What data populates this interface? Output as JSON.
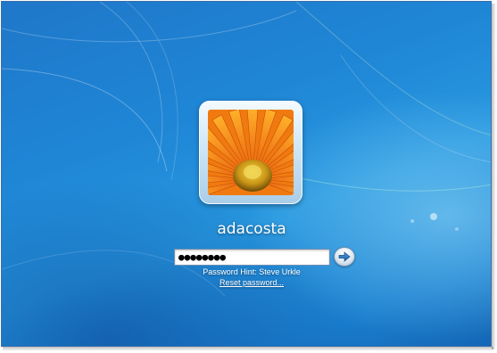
{
  "login": {
    "username": "adacosta",
    "password_masked": "●●●●●●●●",
    "password_hint": "Password Hint: Steve Urkle",
    "reset_link": "Reset password..."
  },
  "icons": {
    "avatar": "orange-gerbera-flower-avatar",
    "submit": "arrow-right-icon"
  },
  "colors": {
    "background": "#1f86d6",
    "avatar_frame": "#cfe6f6",
    "flower_petals": "#f47a0c",
    "flower_center": "#e8b321"
  }
}
